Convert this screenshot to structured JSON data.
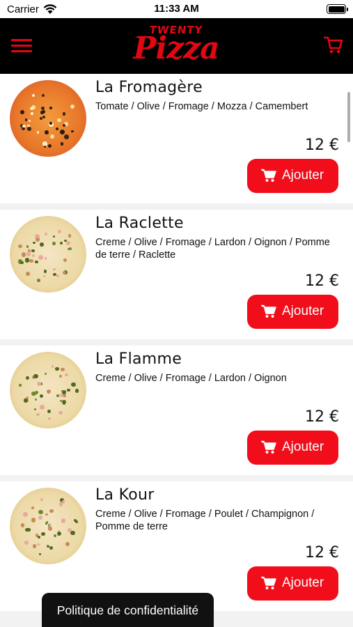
{
  "status_bar": {
    "carrier": "Carrier",
    "time": "11:33 AM"
  },
  "header": {
    "logo_top": "TWENTY",
    "logo_main": "Pizza",
    "menu_icon": "hamburger-menu-icon",
    "cart_icon": "shopping-cart-icon"
  },
  "colors": {
    "brand_red": "#e30613",
    "button_red": "#f10d1a",
    "header_bg": "#000000"
  },
  "products": [
    {
      "name": "La Fromagère",
      "description": "Tomate / Olive / Fromage / Mozza / Camembert",
      "price": "12 €",
      "button_label": "Ajouter",
      "button_icon": "cart-icon",
      "base": "tomate"
    },
    {
      "name": "La Raclette",
      "description": "Creme / Olive / Fromage / Lardon / Oignon / Pomme de terre / Raclette",
      "price": "12 €",
      "button_label": "Ajouter",
      "button_icon": "cart-icon",
      "base": "creme"
    },
    {
      "name": "La Flamme",
      "description": "Creme / Olive / Fromage / Lardon / Oignon",
      "price": "12 €",
      "button_label": "Ajouter",
      "button_icon": "cart-icon",
      "base": "creme"
    },
    {
      "name": "La Kour",
      "description": "Creme / Olive / Fromage / Poulet / Champignon / Pomme de terre",
      "price": "12 €",
      "button_label": "Ajouter",
      "button_icon": "cart-icon",
      "base": "creme"
    }
  ],
  "footer": {
    "privacy_label": "Politique de confidentialité"
  }
}
